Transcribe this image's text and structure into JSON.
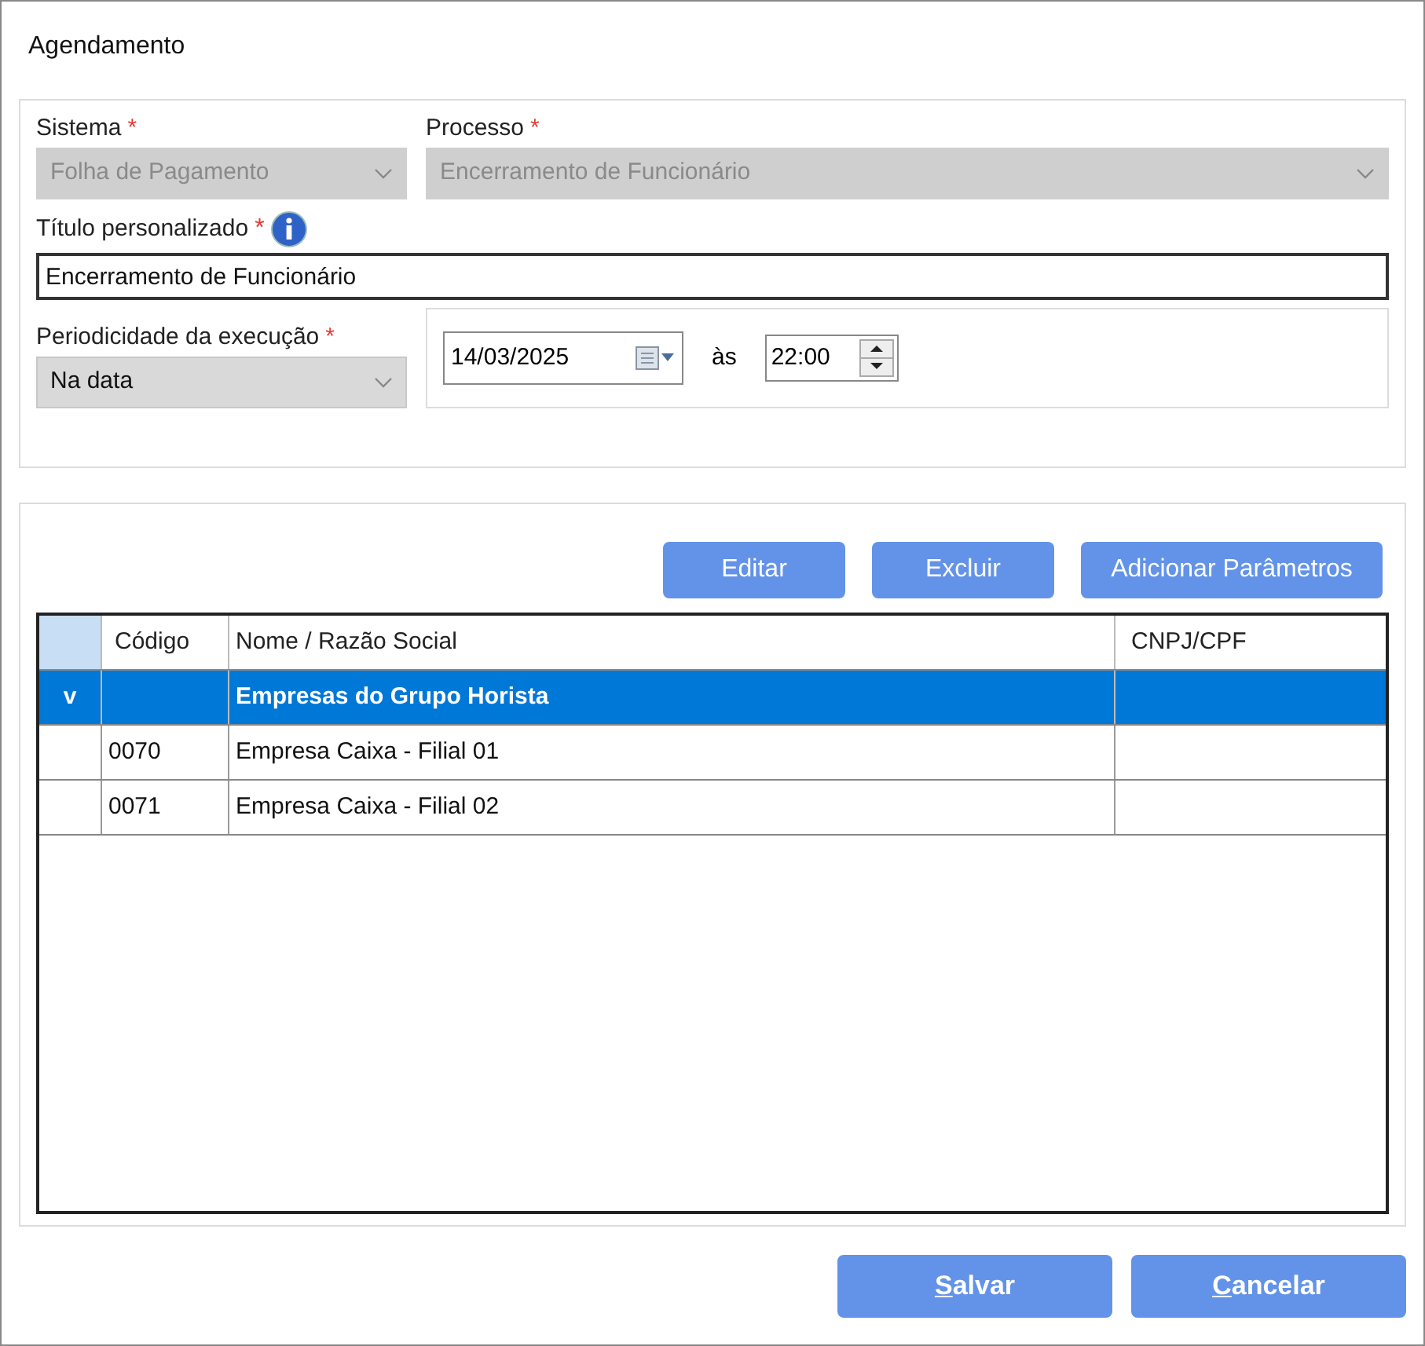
{
  "window": {
    "title": "Agendamento"
  },
  "form": {
    "sistema": {
      "label": "Sistema",
      "required": "*",
      "value": "Folha de Pagamento",
      "disabled": true
    },
    "processo": {
      "label": "Processo",
      "required": "*",
      "value": "Encerramento de Funcionário",
      "disabled": true
    },
    "titulo": {
      "label": "Título personalizado",
      "required": "*",
      "value": "Encerramento de Funcionário"
    },
    "periodicidade": {
      "label": "Periodicidade da execução",
      "required": "*",
      "value": "Na data"
    },
    "date": {
      "value": "14/03/2025"
    },
    "at_label": "às",
    "time": {
      "value": "22:00"
    }
  },
  "toolbar": [
    "Editar",
    "Excluir",
    "Adicionar Parâmetros"
  ],
  "table": {
    "columns": [
      "Código",
      "Nome / Razão Social",
      "CNPJ/CPF"
    ],
    "rows": [
      {
        "kind": "group",
        "marker": "v",
        "cells": [
          "",
          "Empresas do Grupo Horista",
          ""
        ],
        "selected": true
      },
      {
        "kind": "item",
        "cells": [
          "0070",
          "Empresa Caixa - Filial 01",
          ""
        ],
        "selected": false
      },
      {
        "kind": "item",
        "cells": [
          "0071",
          "Empresa Caixa - Filial 02",
          ""
        ],
        "selected": false
      }
    ]
  },
  "footer_buttons": [
    "Salvar",
    "Cancelar"
  ]
}
